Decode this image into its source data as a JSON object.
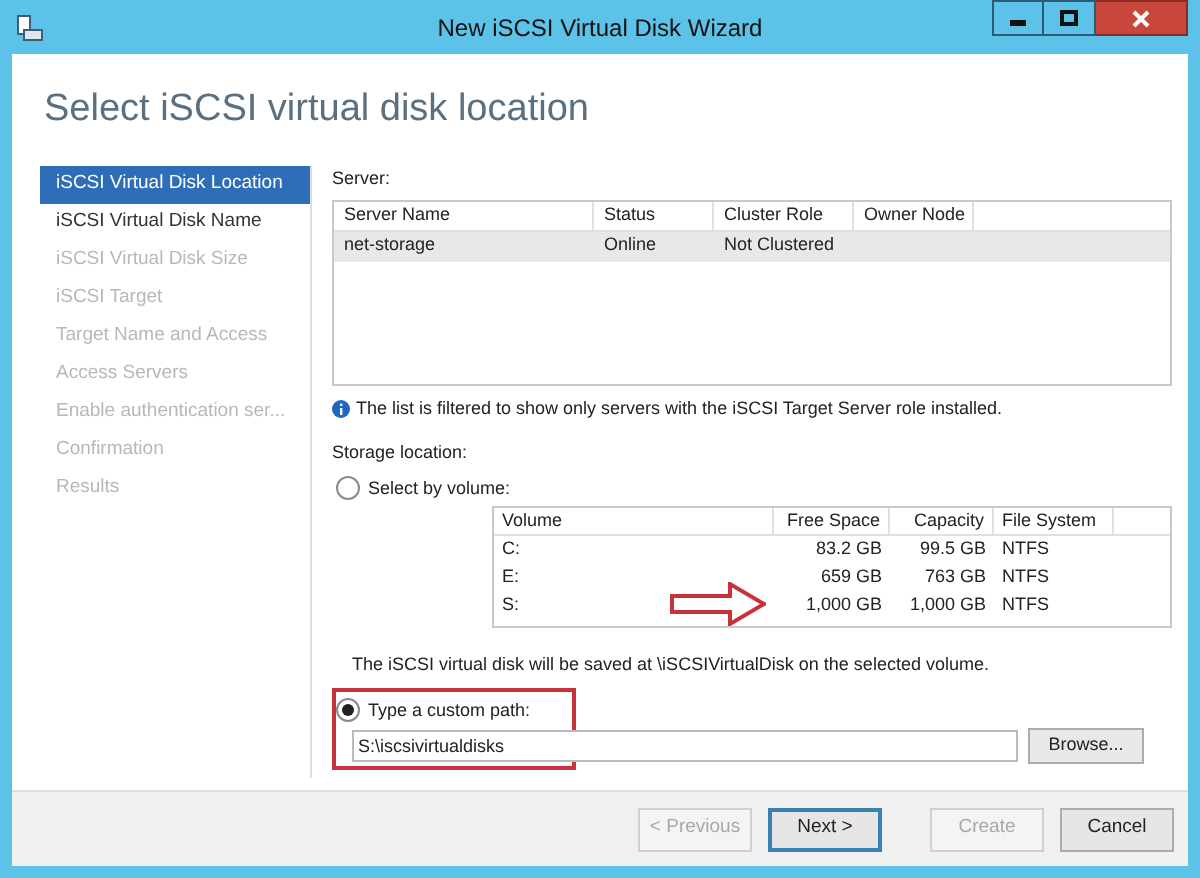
{
  "window": {
    "title": "New iSCSI Virtual Disk Wizard"
  },
  "heading": "Select iSCSI virtual disk location",
  "steps": [
    {
      "label": "iSCSI Virtual Disk Location",
      "selected": true,
      "disabled": false
    },
    {
      "label": "iSCSI Virtual Disk Name",
      "selected": false,
      "disabled": false
    },
    {
      "label": "iSCSI Virtual Disk Size",
      "selected": false,
      "disabled": true
    },
    {
      "label": "iSCSI Target",
      "selected": false,
      "disabled": true
    },
    {
      "label": "Target Name and Access",
      "selected": false,
      "disabled": true
    },
    {
      "label": "Access Servers",
      "selected": false,
      "disabled": true
    },
    {
      "label": "Enable authentication ser...",
      "selected": false,
      "disabled": true
    },
    {
      "label": "Confirmation",
      "selected": false,
      "disabled": true
    },
    {
      "label": "Results",
      "selected": false,
      "disabled": true
    }
  ],
  "server": {
    "label": "Server:",
    "columns": [
      "Server Name",
      "Status",
      "Cluster Role",
      "Owner Node"
    ],
    "rows": [
      {
        "cells": [
          "net-storage",
          "Online",
          "Not Clustered",
          ""
        ],
        "selected": true
      }
    ],
    "info": "The list is filtered to show only servers with the iSCSI Target Server role installed."
  },
  "storage": {
    "label": "Storage location:",
    "by_volume": {
      "label": "Select by volume:",
      "selected": false
    },
    "volume_columns": [
      "Volume",
      "Free Space",
      "Capacity",
      "File System"
    ],
    "volumes": [
      {
        "cells": [
          "C:",
          "83.2 GB",
          "99.5 GB",
          "NTFS"
        ],
        "highlighted": false
      },
      {
        "cells": [
          "E:",
          "659 GB",
          "763 GB",
          "NTFS"
        ],
        "highlighted": false
      },
      {
        "cells": [
          "S:",
          "1,000 GB",
          "1,000 GB",
          "NTFS"
        ],
        "highlighted": true
      }
    ],
    "note": "The iSCSI virtual disk will be saved at \\iSCSIVirtualDisk on the selected volume.",
    "custom": {
      "label": "Type a custom path:",
      "selected": true,
      "highlighted": true
    },
    "path": {
      "value": "S:\\iscsivirtualdisks"
    },
    "browse": "Browse..."
  },
  "buttons": [
    {
      "label": "< Previous",
      "disabled": true,
      "default": false
    },
    {
      "label": "Next >",
      "disabled": false,
      "default": true
    },
    {
      "label": "Create",
      "disabled": true,
      "default": false
    },
    {
      "label": "Cancel",
      "disabled": false,
      "default": false
    }
  ]
}
